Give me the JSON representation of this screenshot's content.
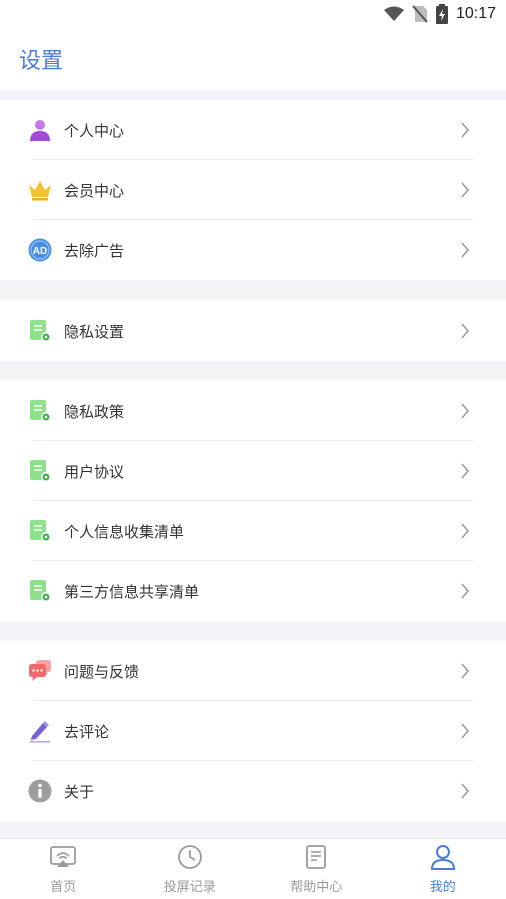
{
  "status_bar": {
    "time": "10:17",
    "icons": [
      "wifi-icon",
      "no-sim-icon",
      "battery-charging-icon"
    ]
  },
  "header": {
    "title": "设置"
  },
  "groups": [
    {
      "items": [
        {
          "label": "个人中心",
          "icon": "person-icon"
        },
        {
          "label": "会员中心",
          "icon": "crown-icon"
        },
        {
          "label": "去除广告",
          "icon": "ad-icon"
        }
      ]
    },
    {
      "items": [
        {
          "label": "隐私设置",
          "icon": "document-gear-icon"
        }
      ]
    },
    {
      "items": [
        {
          "label": "隐私政策",
          "icon": "document-gear-icon"
        },
        {
          "label": "用户协议",
          "icon": "document-gear-icon"
        },
        {
          "label": "个人信息收集清单",
          "icon": "document-gear-icon"
        },
        {
          "label": "第三方信息共享清单",
          "icon": "document-gear-icon"
        }
      ]
    },
    {
      "items": [
        {
          "label": "问题与反馈",
          "icon": "chat-bubble-icon"
        },
        {
          "label": "去评论",
          "icon": "pen-icon"
        },
        {
          "label": "关于",
          "icon": "info-icon"
        }
      ]
    }
  ],
  "tabbar": {
    "tabs": [
      {
        "label": "首页",
        "icon": "cast-screen-icon",
        "active": false
      },
      {
        "label": "投屏记录",
        "icon": "clock-icon",
        "active": false
      },
      {
        "label": "帮助中心",
        "icon": "book-icon",
        "active": false
      },
      {
        "label": "我的",
        "icon": "user-icon",
        "active": true
      }
    ]
  },
  "colors": {
    "accent": "#4a7ddb",
    "background": "#f3f4f8",
    "person": "#b05ce0",
    "crown": "#f4c034",
    "ad": "#4a90e2",
    "document": "#8fe08a",
    "chat": "#ef6b6b",
    "pen": "#7b61d9",
    "info": "#9e9e9e"
  }
}
